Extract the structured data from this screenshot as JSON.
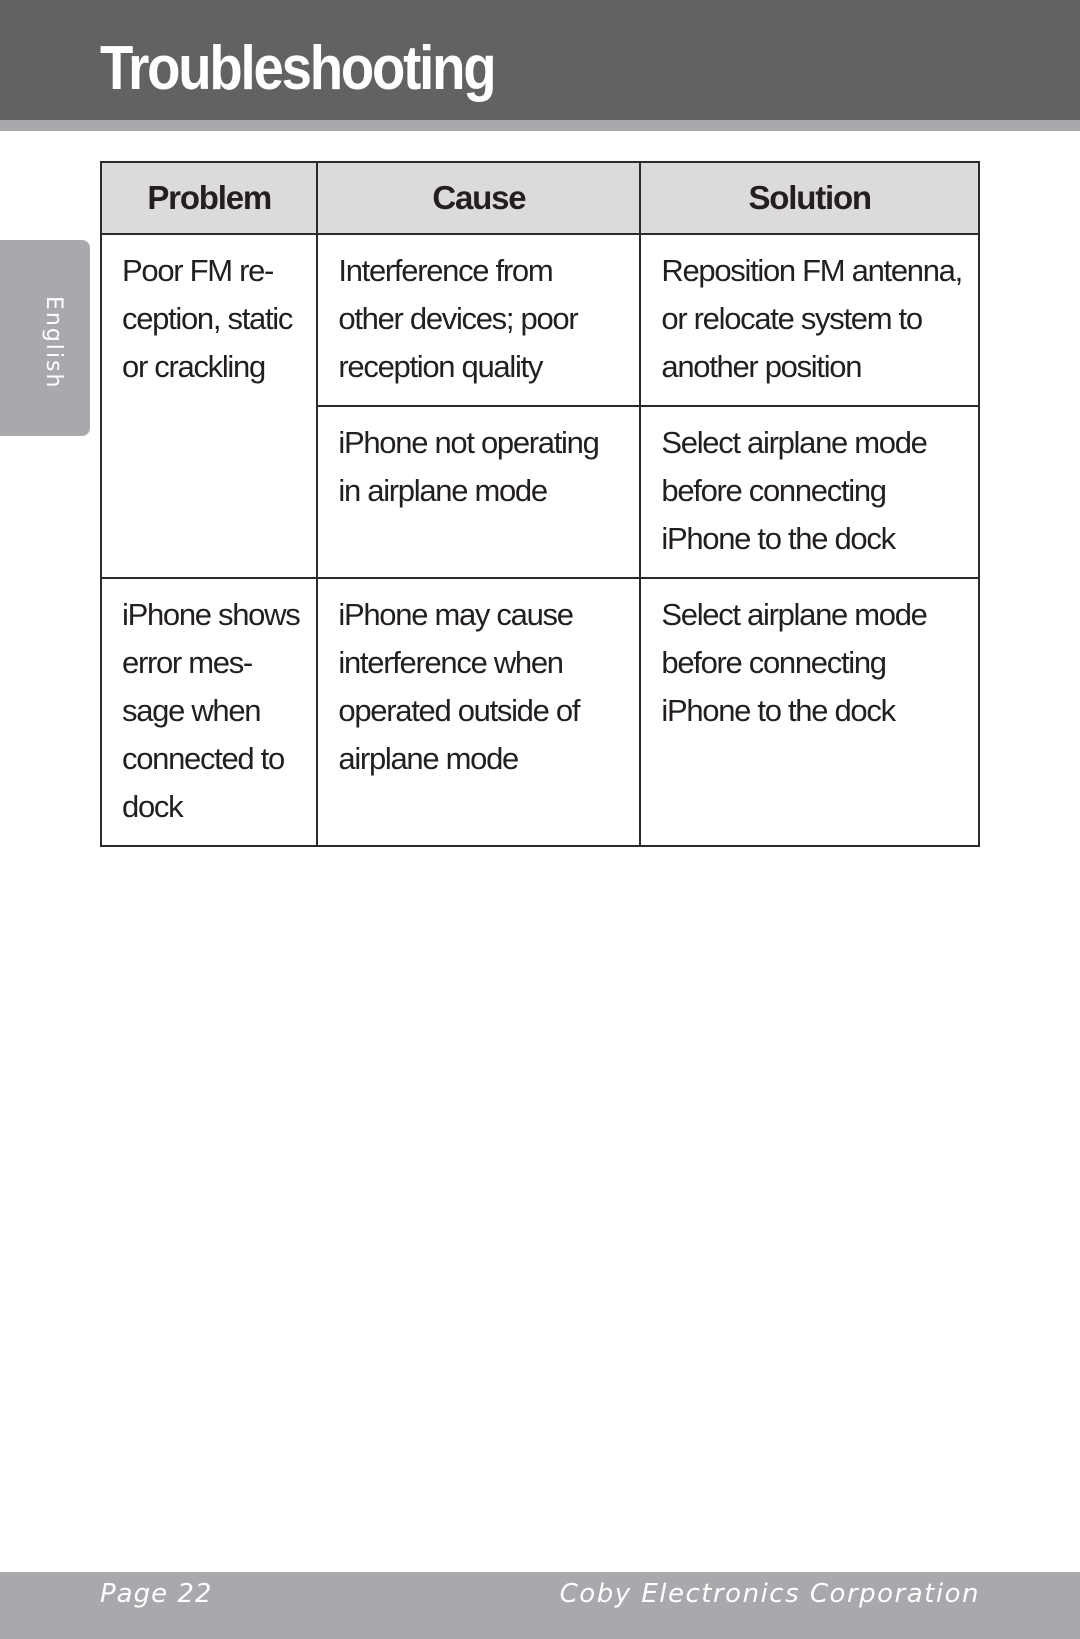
{
  "header": {
    "title": "Troubleshooting"
  },
  "side_tab": {
    "language": "English"
  },
  "table": {
    "columns": [
      "Problem",
      "Cause",
      "Solution"
    ],
    "rows": [
      {
        "problem": [
          "Poor FM re-",
          "ception, static",
          "or crackling"
        ],
        "causes": [
          {
            "cause": [
              "Interference from",
              "other devices; poor",
              "reception quality"
            ],
            "solution": [
              "Reposition FM antenna,",
              "or relocate system to",
              "another position"
            ]
          },
          {
            "cause": [
              "iPhone not operating",
              "in airplane mode"
            ],
            "solution": [
              "Select airplane mode",
              "before connecting",
              "iPhone to the dock"
            ]
          }
        ]
      },
      {
        "problem": [
          "iPhone shows",
          "error mes-",
          "sage when",
          "connected to",
          "dock"
        ],
        "causes": [
          {
            "cause": [
              "iPhone may cause",
              "interference when",
              "operated outside of",
              "airplane mode"
            ],
            "solution": [
              "Select airplane mode",
              "before connecting",
              "iPhone to the dock"
            ]
          }
        ]
      }
    ]
  },
  "footer": {
    "page_label": "Page 22",
    "company": "Coby Electronics Corporation"
  },
  "colors": {
    "header_band": "#616264",
    "accent_gray": "#a8a9ad",
    "table_header_bg": "#dcdadb",
    "text": "#231f20"
  }
}
